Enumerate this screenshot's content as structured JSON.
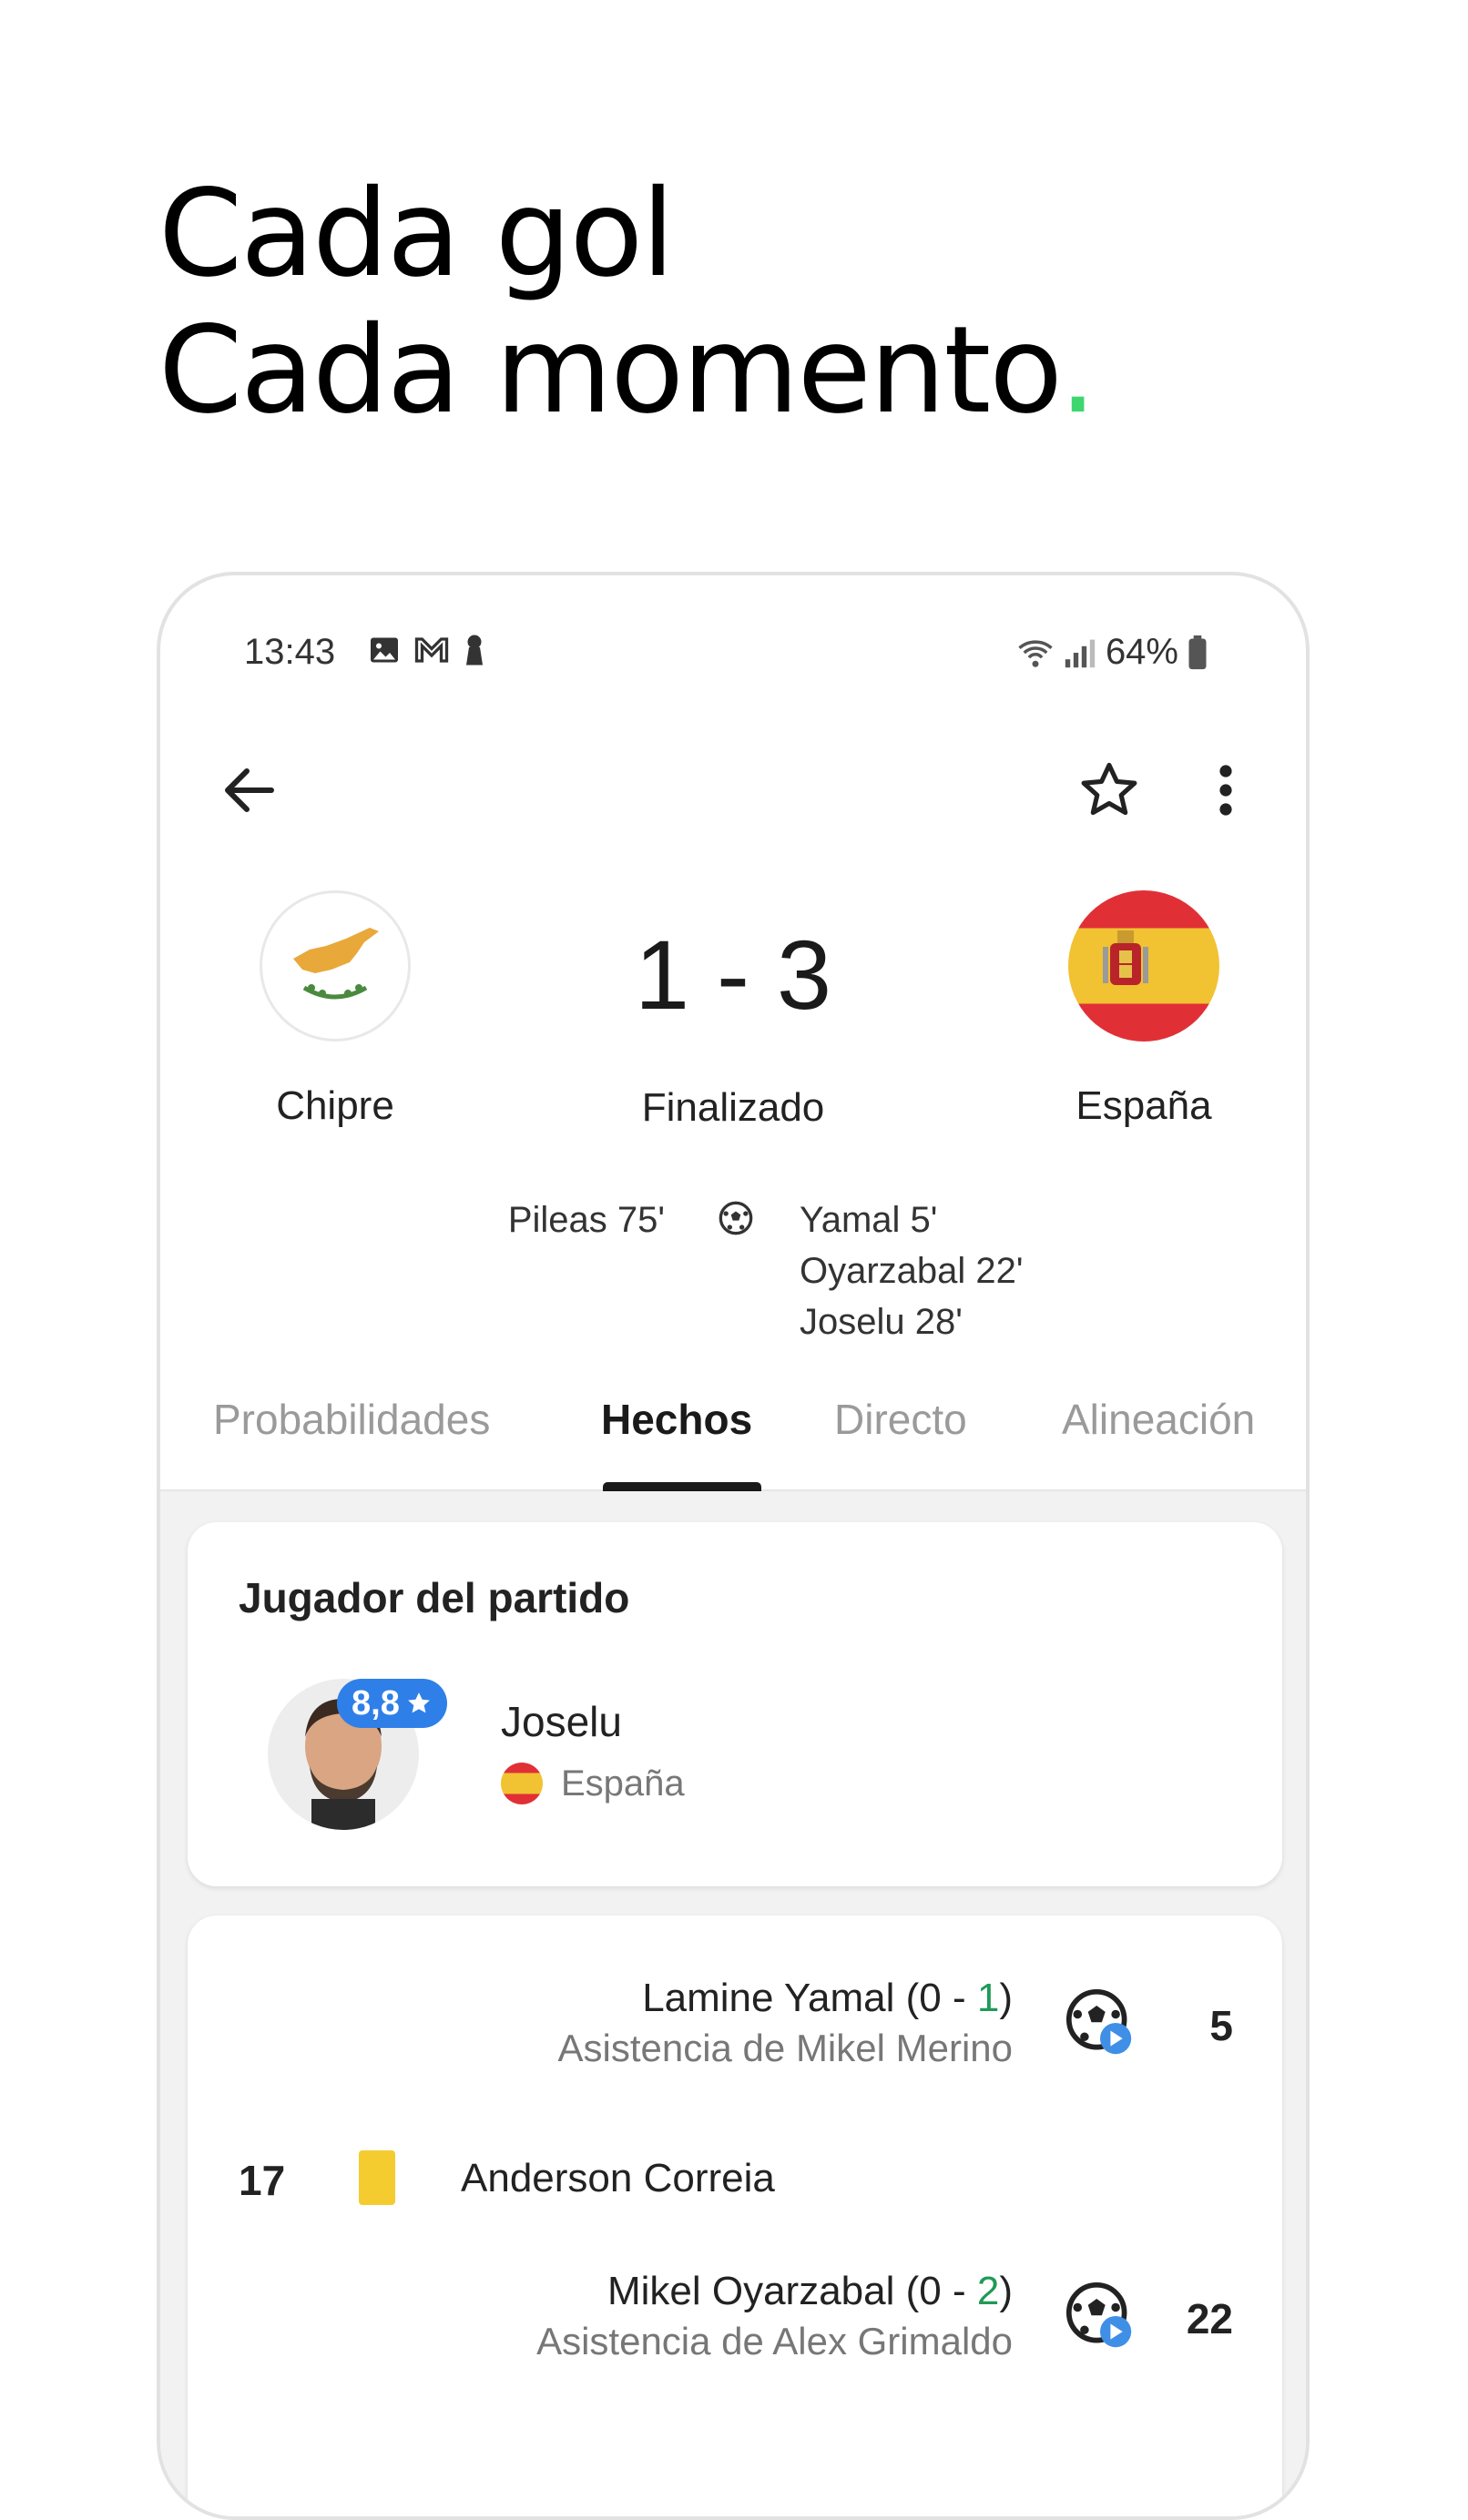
{
  "headline": {
    "line1": "Cada gol",
    "line2": "Cada momento",
    "dot": "."
  },
  "status_bar": {
    "time": "13:43",
    "battery": "64%"
  },
  "match": {
    "home_team": "Chipre",
    "away_team": "España",
    "score": "1 - 3",
    "status": "Finalizado",
    "home_scorers": [
      "Pileas 75'"
    ],
    "away_scorers": [
      "Yamal 5'",
      "Oyarzabal 22'",
      "Joselu 28'"
    ]
  },
  "tabs": [
    "Probabilidades",
    "Hechos",
    "Directo",
    "Alineación"
  ],
  "active_tab": "Hechos",
  "player_of_match": {
    "title": "Jugador del partido",
    "rating": "8,8",
    "name": "Joselu",
    "country": "España"
  },
  "events": [
    {
      "type": "goal",
      "side": "away",
      "player": "Lamine Yamal",
      "score_pre": "(0 - ",
      "score_hl": "1",
      "score_post": ")",
      "assist": "Asistencia de Mikel Merino",
      "minute": "5"
    },
    {
      "type": "yellow_card",
      "side": "home",
      "player": "Anderson Correia",
      "minute": "17"
    },
    {
      "type": "goal",
      "side": "away",
      "player": "Mikel Oyarzabal",
      "score_pre": "(0 - ",
      "score_hl": "2",
      "score_post": ")",
      "assist": "Asistencia de Alex Grimaldo",
      "minute": "22"
    }
  ],
  "colors": {
    "accent_green": "#3ed66f",
    "rating_blue": "#2f7fe8",
    "yellow_card": "#f4cc30",
    "score_green": "#1f9a57"
  }
}
